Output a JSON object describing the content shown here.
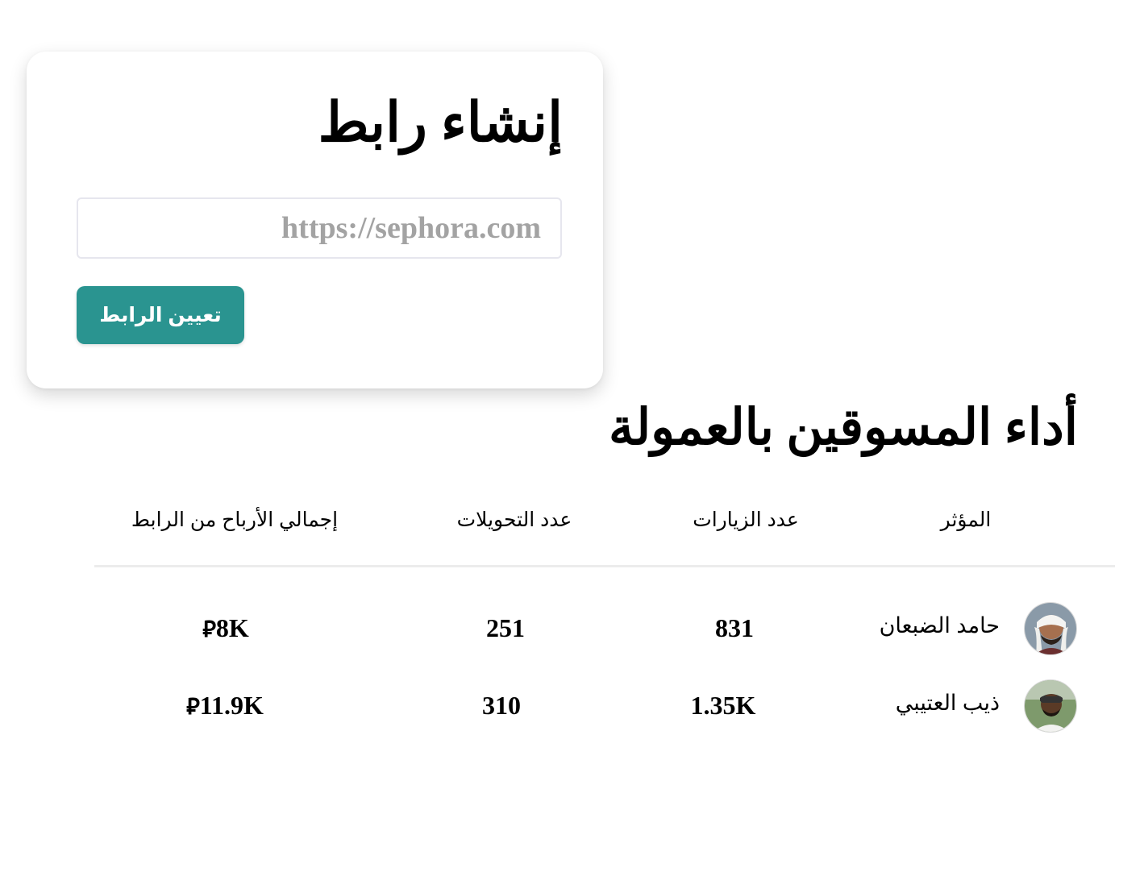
{
  "create_link": {
    "title": "إنشاء رابط",
    "url_placeholder": "https://sephora.com",
    "url_value": "",
    "button_label": "تعيين الرابط"
  },
  "performance": {
    "title": "أداء المسوقين بالعمولة",
    "columns": {
      "influencer": "المؤثر",
      "visits": "عدد الزيارات",
      "conversions": "عدد التحويلات",
      "earnings": "إجمالي الأرباح من الرابط"
    },
    "currency_symbol": "⃁",
    "rows": [
      {
        "name": "حامد الضبعان",
        "visits": "831",
        "conversions": "251",
        "earnings": "8K",
        "avatar": "avatar-man-with-headscarf"
      },
      {
        "name": "ذيب العتيبي",
        "visits": "1.35K",
        "conversions": "310",
        "earnings": "11.9K",
        "avatar": "avatar-man-with-beanie"
      }
    ]
  },
  "colors": {
    "accent": "#2a9490",
    "divider": "#ececec",
    "input_border": "#e6e6ee",
    "placeholder": "#a3a3a3"
  }
}
